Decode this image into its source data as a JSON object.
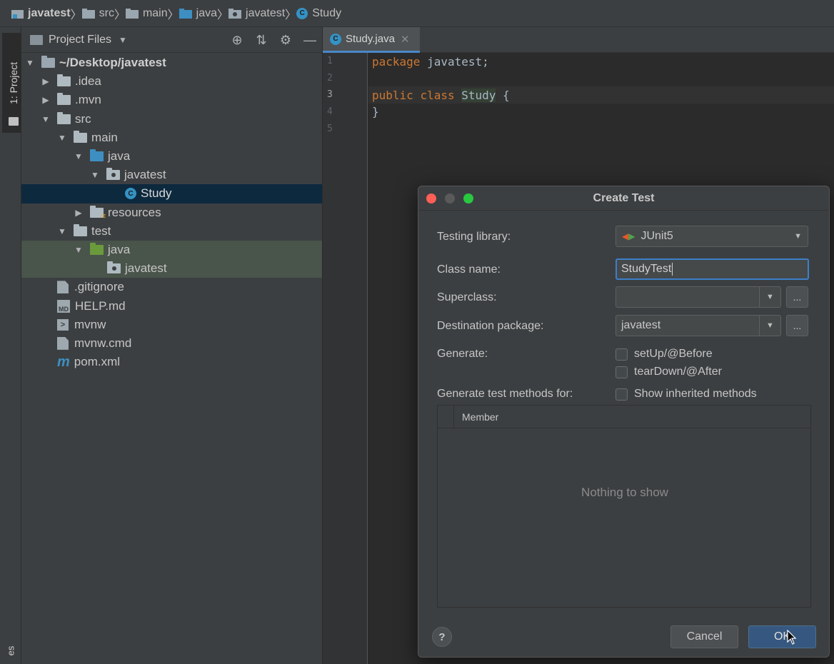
{
  "breadcrumb": {
    "items": [
      {
        "label": "javatest",
        "icon": "project-folder-icon"
      },
      {
        "label": "src",
        "icon": "folder-icon"
      },
      {
        "label": "main",
        "icon": "folder-icon"
      },
      {
        "label": "java",
        "icon": "source-folder-icon"
      },
      {
        "label": "javatest",
        "icon": "package-icon"
      },
      {
        "label": "Study",
        "icon": "class-icon"
      }
    ],
    "class_badge": "C"
  },
  "stripe": {
    "project_tab": "1: Project",
    "bottom_tab": "es"
  },
  "project_panel": {
    "title": "Project Files",
    "tree": [
      {
        "label": "~/Desktop/javatest",
        "bold": true
      },
      {
        "label": ".idea"
      },
      {
        "label": ".mvn"
      },
      {
        "label": "src"
      },
      {
        "label": "main"
      },
      {
        "label": "java"
      },
      {
        "label": "javatest"
      },
      {
        "label": "Study"
      },
      {
        "label": "resources"
      },
      {
        "label": "test"
      },
      {
        "label": "java"
      },
      {
        "label": "javatest"
      },
      {
        "label": ".gitignore"
      },
      {
        "label": "HELP.md"
      },
      {
        "label": "mvnw"
      },
      {
        "label": "mvnw.cmd"
      },
      {
        "label": "pom.xml"
      }
    ],
    "md_badge": "MD",
    "pom_badge": "m",
    "sh_badge": ">"
  },
  "editor": {
    "tab_label": "Study.java",
    "tab_badge": "C",
    "line_numbers": [
      "1",
      "2",
      "3",
      "4",
      "5"
    ],
    "code": {
      "l1_kw": "package",
      "l1_rest": " javatest;",
      "l3_kw1": "public",
      "l3_kw2": "class",
      "l3_cls": "Study",
      "l3_rest": " {",
      "l4": "}"
    }
  },
  "dialog": {
    "title": "Create Test",
    "testing_library_label": "Testing library:",
    "testing_library_value": "JUnit5",
    "class_name_label": "Class name:",
    "class_name_value": "StudyTest",
    "superclass_label": "Superclass:",
    "superclass_value": "",
    "destination_label": "Destination package:",
    "destination_value": "javatest",
    "dots": "...",
    "generate_label": "Generate:",
    "setup_label": "setUp/@Before",
    "teardown_label": "tearDown/@After",
    "methods_label": "Generate test methods for:",
    "inherited_label": "Show inherited methods",
    "member_header": "Member",
    "empty_text": "Nothing to show",
    "help": "?",
    "cancel_label": "Cancel",
    "ok_label": "OK"
  }
}
